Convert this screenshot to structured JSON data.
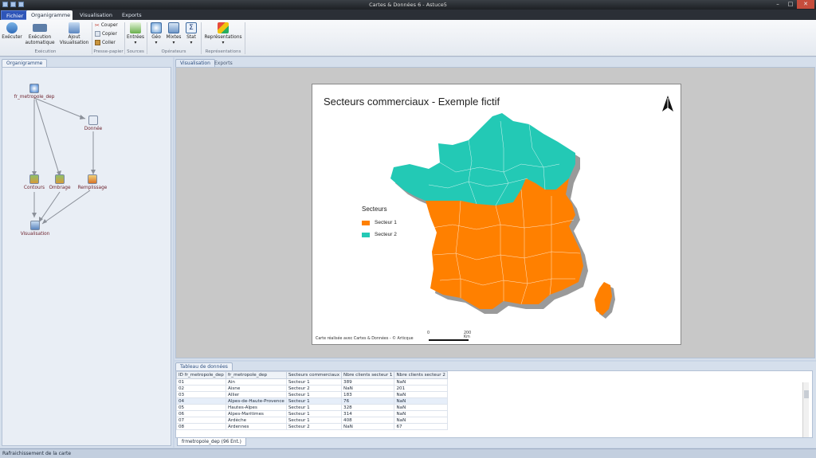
{
  "window": {
    "title": "Cartes & Données 6 - Astuce5"
  },
  "tabs": [
    {
      "label": "Fichier"
    },
    {
      "label": "Organigramme"
    },
    {
      "label": "Visualisation"
    },
    {
      "label": "Exports"
    }
  ],
  "ribbon": {
    "executer": "Exécuter",
    "execution_auto": "Exécution automatique",
    "ajout_visu": "Ajout Visualisation",
    "group_execution": "Exécution",
    "couper": "Couper",
    "copier": "Copier",
    "coller": "Coller",
    "group_presse": "Presse-papier",
    "entrees": "Entrées",
    "group_sources": "Sources",
    "geo": "Géo",
    "mixtes": "Mixtes",
    "stat": "Stat",
    "group_operateurs": "Opérateurs",
    "representations": "Représentations",
    "group_representations": "Représentations"
  },
  "left_pane": {
    "tab": "Organigramme",
    "nodes": {
      "source": "fr_metropole_dep",
      "donnee": "Donnée",
      "contours": "Contours",
      "ombrage": "Ombrage",
      "remplissage": "Remplissage",
      "visualisation": "Visualisation"
    }
  },
  "main_pane": {
    "tabs": [
      "Visualisation",
      "Exports"
    ],
    "map": {
      "title": "Secteurs commerciaux - Exemple fictif",
      "legend_title": "Secteurs",
      "legend": [
        {
          "label": "Secteur 1",
          "color": "#ff8000"
        },
        {
          "label": "Secteur 2",
          "color": "#23c9b5"
        }
      ],
      "credit": "Carte réalisée avec Cartes & Données - © Articque",
      "scale_start": "0",
      "scale_end": "200 Km"
    }
  },
  "table_pane": {
    "tab": "Tableau de données",
    "columns": [
      "ID fr_metropole_dep",
      "fr_metropole_dep",
      "Secteurs commerciaux",
      "Nbre clients secteur 1",
      "Nbre clients secteur 2"
    ],
    "rows": [
      [
        "01",
        "Ain",
        "Secteur 1",
        "389",
        "NaN"
      ],
      [
        "02",
        "Aisne",
        "Secteur 2",
        "NaN",
        "201"
      ],
      [
        "03",
        "Allier",
        "Secteur 1",
        "183",
        "NaN"
      ],
      [
        "04",
        "Alpes-de-Haute-Provence",
        "Secteur 1",
        "76",
        "NaN"
      ],
      [
        "05",
        "Hautes-Alpes",
        "Secteur 1",
        "328",
        "NaN"
      ],
      [
        "06",
        "Alpes-Maritimes",
        "Secteur 1",
        "314",
        "NaN"
      ],
      [
        "07",
        "Ardèche",
        "Secteur 1",
        "408",
        "NaN"
      ],
      [
        "08",
        "Ardennes",
        "Secteur 2",
        "NaN",
        "67"
      ]
    ],
    "bottom_tab": "frmetropole_dep (96 Ent.)"
  },
  "status": {
    "text": "Rafraichissement de la carte"
  },
  "colors": {
    "accent": "#2e55b8",
    "secteur1": "#ff8000",
    "secteur2": "#23c9b5"
  }
}
